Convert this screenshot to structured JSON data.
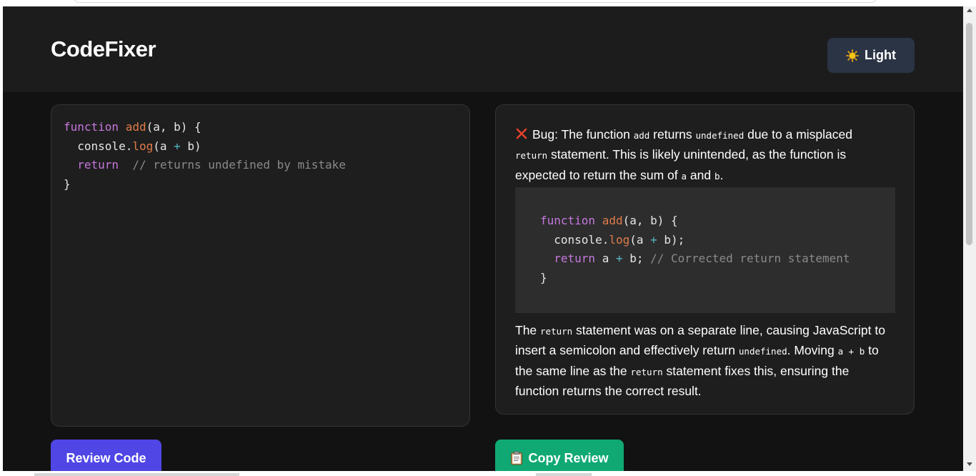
{
  "app": {
    "title": "CodeFixer",
    "theme_toggle_label": "Light",
    "theme_toggle_icon": "sun-icon"
  },
  "editor": {
    "lines": [
      [
        {
          "t": "kw",
          "v": "function"
        },
        {
          "t": "pl",
          "v": " "
        },
        {
          "t": "fn",
          "v": "add"
        },
        {
          "t": "pl",
          "v": "(a, b) {"
        }
      ],
      [
        {
          "t": "pl",
          "v": "  console."
        },
        {
          "t": "fn",
          "v": "log"
        },
        {
          "t": "pl",
          "v": "(a "
        },
        {
          "t": "op",
          "v": "+"
        },
        {
          "t": "pl",
          "v": " b)"
        }
      ],
      [
        {
          "t": "pl",
          "v": "  "
        },
        {
          "t": "kw",
          "v": "return"
        },
        {
          "t": "pl",
          "v": "  "
        },
        {
          "t": "cm",
          "v": "// returns undefined by mistake"
        }
      ],
      [
        {
          "t": "pl",
          "v": "}"
        }
      ]
    ]
  },
  "review": {
    "bug_icon": "x-icon",
    "para1": [
      {
        "t": "text",
        "v": "Bug: The function "
      },
      {
        "t": "code",
        "v": "add"
      },
      {
        "t": "text",
        "v": " returns "
      },
      {
        "t": "code",
        "v": "undefined"
      },
      {
        "t": "text",
        "v": " due to a misplaced "
      },
      {
        "t": "code",
        "v": "return"
      },
      {
        "t": "text",
        "v": " statement. This is likely unintended, as the function is expected to return the sum of "
      },
      {
        "t": "code",
        "v": "a"
      },
      {
        "t": "text",
        "v": " and "
      },
      {
        "t": "code",
        "v": "b"
      },
      {
        "t": "text",
        "v": "."
      }
    ],
    "fixed_code": [
      [
        {
          "t": "kw",
          "v": "function"
        },
        {
          "t": "pl",
          "v": " "
        },
        {
          "t": "fn",
          "v": "add"
        },
        {
          "t": "pl",
          "v": "(a, b) {"
        }
      ],
      [
        {
          "t": "pl",
          "v": "  console."
        },
        {
          "t": "fn",
          "v": "log"
        },
        {
          "t": "pl",
          "v": "(a "
        },
        {
          "t": "op",
          "v": "+"
        },
        {
          "t": "pl",
          "v": " b);"
        }
      ],
      [
        {
          "t": "pl",
          "v": "  "
        },
        {
          "t": "kw",
          "v": "return"
        },
        {
          "t": "pl",
          "v": " a "
        },
        {
          "t": "op",
          "v": "+"
        },
        {
          "t": "pl",
          "v": " b; "
        },
        {
          "t": "cm",
          "v": "// Corrected return statement"
        }
      ],
      [
        {
          "t": "pl",
          "v": "}"
        }
      ]
    ],
    "para2": [
      {
        "t": "text",
        "v": "The "
      },
      {
        "t": "code",
        "v": "return"
      },
      {
        "t": "text",
        "v": " statement was on a separate line, causing JavaScript to insert a semicolon and effectively return "
      },
      {
        "t": "code",
        "v": "undefined"
      },
      {
        "t": "text",
        "v": ". Moving "
      },
      {
        "t": "code",
        "v": "a + b"
      },
      {
        "t": "text",
        "v": " to the same line as the "
      },
      {
        "t": "code",
        "v": "return"
      },
      {
        "t": "text",
        "v": " statement fixes this, ensuring the function returns the correct result."
      }
    ]
  },
  "buttons": {
    "review_label": "Review Code",
    "copy_label": "Copy Review",
    "copy_icon": "clipboard-icon"
  },
  "colors": {
    "keyword": "#c678dd",
    "function": "#e07c4c",
    "operator": "#56b6c2",
    "comment": "#8a8a8a",
    "review_button": "#4f46e5",
    "copy_button": "#10a974",
    "theme_button": "#2a3444",
    "bug_icon": "#e5412d"
  }
}
